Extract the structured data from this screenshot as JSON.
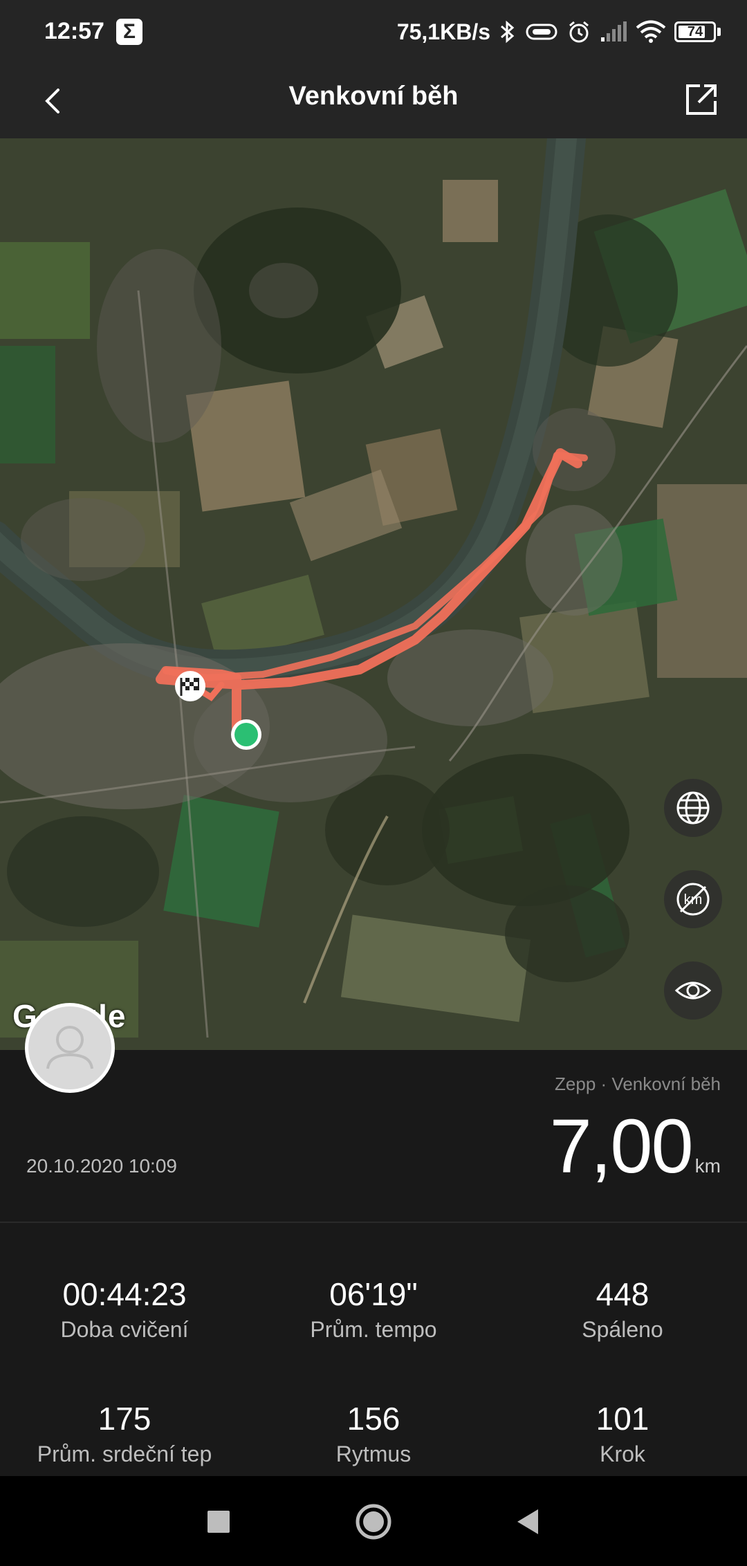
{
  "status_bar": {
    "time": "12:57",
    "sigma_icon": "Σ",
    "net_speed": "75,1KB/s",
    "battery": "74"
  },
  "header": {
    "title": "Venkovní běh"
  },
  "map": {
    "attribution": "Google",
    "route_color": "#f0705a",
    "start_color": "#2bbf73"
  },
  "summary": {
    "source": "Zepp · Venkovní běh",
    "distance": "7,00",
    "distance_unit": "km",
    "date": "20.10.2020 10:09"
  },
  "stats": [
    {
      "value": "00:44:23",
      "label": "Doba cvičení"
    },
    {
      "value": "06'19\"",
      "label": "Prům. tempo"
    },
    {
      "value": "448",
      "label": "Spáleno"
    },
    {
      "value": "175",
      "label": "Prům. srdeční tep"
    },
    {
      "value": "156",
      "label": "Rytmus"
    },
    {
      "value": "101",
      "label": "Krok"
    }
  ]
}
